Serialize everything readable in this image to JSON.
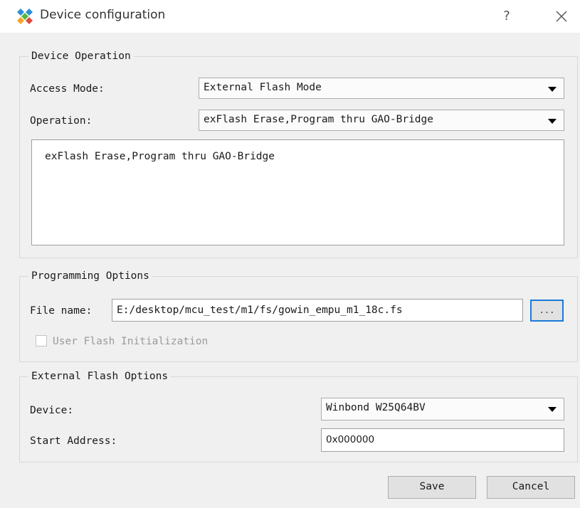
{
  "window": {
    "title": "Device configuration",
    "help_label": "?",
    "icon": "app-logo-icon",
    "close_icon": "close-icon"
  },
  "device_operation": {
    "group_title": "Device Operation",
    "access_mode_label": "Access Mode:",
    "access_mode_value": "External Flash Mode",
    "operation_label": "Operation:",
    "operation_value": "exFlash Erase,Program thru GAO-Bridge",
    "description": "exFlash Erase,Program thru GAO-Bridge"
  },
  "programming_options": {
    "group_title": "Programming Options",
    "file_name_label": "File name:",
    "file_name_value": "E:/desktop/mcu_test/m1/fs/gowin_empu_m1_18c.fs",
    "browse_label": "...",
    "user_flash_label": "User Flash Initialization"
  },
  "external_flash_options": {
    "group_title": "External Flash Options",
    "device_label": "Device:",
    "device_value": "Winbond W25Q64BV",
    "start_address_label": "Start Address:",
    "start_address_value": "0x000000"
  },
  "footer": {
    "save_label": "Save",
    "cancel_label": "Cancel"
  },
  "colors": {
    "accent": "#1b7ad9",
    "background": "#f0f0f0"
  }
}
